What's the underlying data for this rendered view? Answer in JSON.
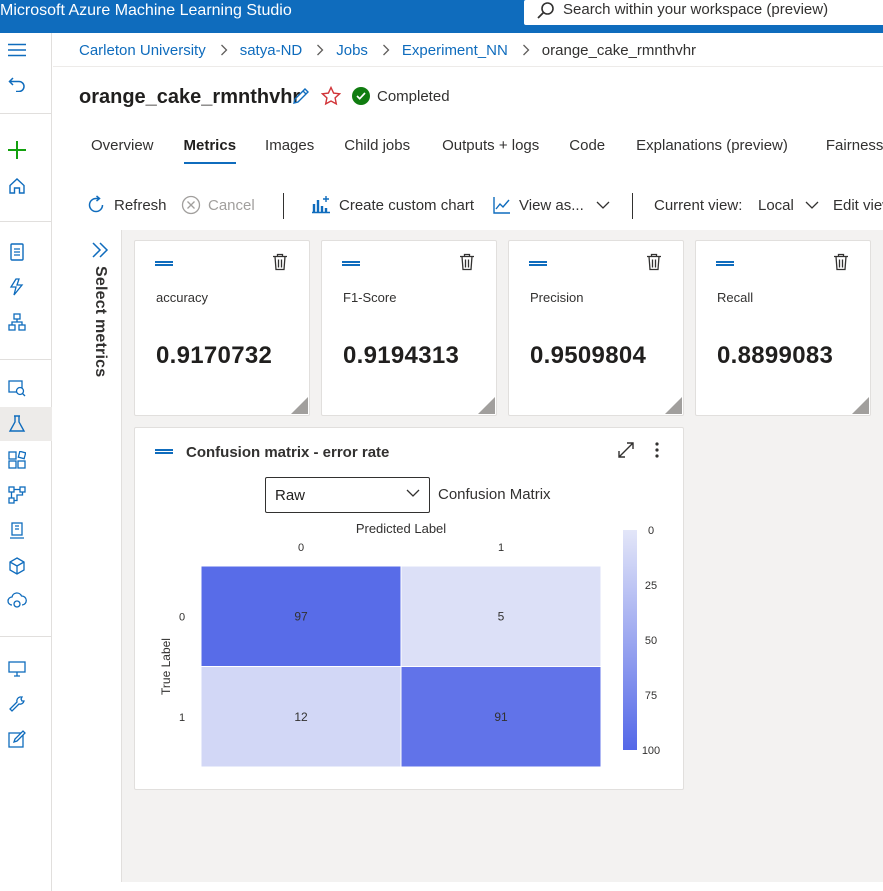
{
  "app": {
    "title": "Microsoft Azure Machine Learning Studio",
    "search_placeholder": "Search within your workspace (preview)"
  },
  "rail": {
    "items": [
      "menu-icon",
      "back-icon",
      "add-icon",
      "home-icon",
      "notebook-icon",
      "automl-icon",
      "designer-icon",
      "data-icon",
      "jobs-icon",
      "components-icon",
      "pipelines-icon",
      "environments-icon",
      "models-icon",
      "endpoints-icon",
      "compute-icon",
      "linked-services-icon",
      "data-labeling-icon"
    ]
  },
  "breadcrumb": {
    "items": [
      "Carleton University",
      "satya-ND",
      "Jobs",
      "Experiment_NN"
    ],
    "current": "orange_cake_rmnthvhr"
  },
  "run": {
    "name": "orange_cake_rmnthvhr",
    "status": "Completed",
    "status_color": "#107c10"
  },
  "tabs": [
    "Overview",
    "Metrics",
    "Images",
    "Child jobs",
    "Outputs + logs",
    "Code",
    "Explanations (preview)",
    "Fairness"
  ],
  "active_tab": "Metrics",
  "toolbar": {
    "refresh": "Refresh",
    "cancel": "Cancel",
    "create_chart": "Create custom chart",
    "view_as": "View as...",
    "current_view_label": "Current view:",
    "current_view_value": "Local",
    "edit_view": "Edit view"
  },
  "select_metrics_label": "Select metrics",
  "metric_cards": [
    {
      "name": "accuracy",
      "value": "0.9170732"
    },
    {
      "name": "F1-Score",
      "value": "0.9194313"
    },
    {
      "name": "Precision",
      "value": "0.9509804"
    },
    {
      "name": "Recall",
      "value": "0.8899083"
    }
  ],
  "confusion_card": {
    "title": "Confusion matrix - error rate",
    "select_value": "Raw",
    "select_label": "Confusion Matrix"
  },
  "chart_data": {
    "type": "heatmap",
    "title": "Predicted Label",
    "xlabel": "Predicted Label",
    "ylabel": "True Label",
    "x_categories": [
      "0",
      "1"
    ],
    "y_categories": [
      "0",
      "1"
    ],
    "values": [
      [
        97,
        5
      ],
      [
        12,
        91
      ]
    ],
    "colorbar_ticks": [
      "0",
      "25",
      "50",
      "75",
      "100"
    ],
    "colorbar_range": [
      0,
      100
    ],
    "color_low": "#e3e6f8",
    "color_high": "#5468e8"
  },
  "colors": {
    "topbar": "#0f6cbd",
    "link": "#0f6cbd",
    "content_bg": "#f3f2f1"
  }
}
